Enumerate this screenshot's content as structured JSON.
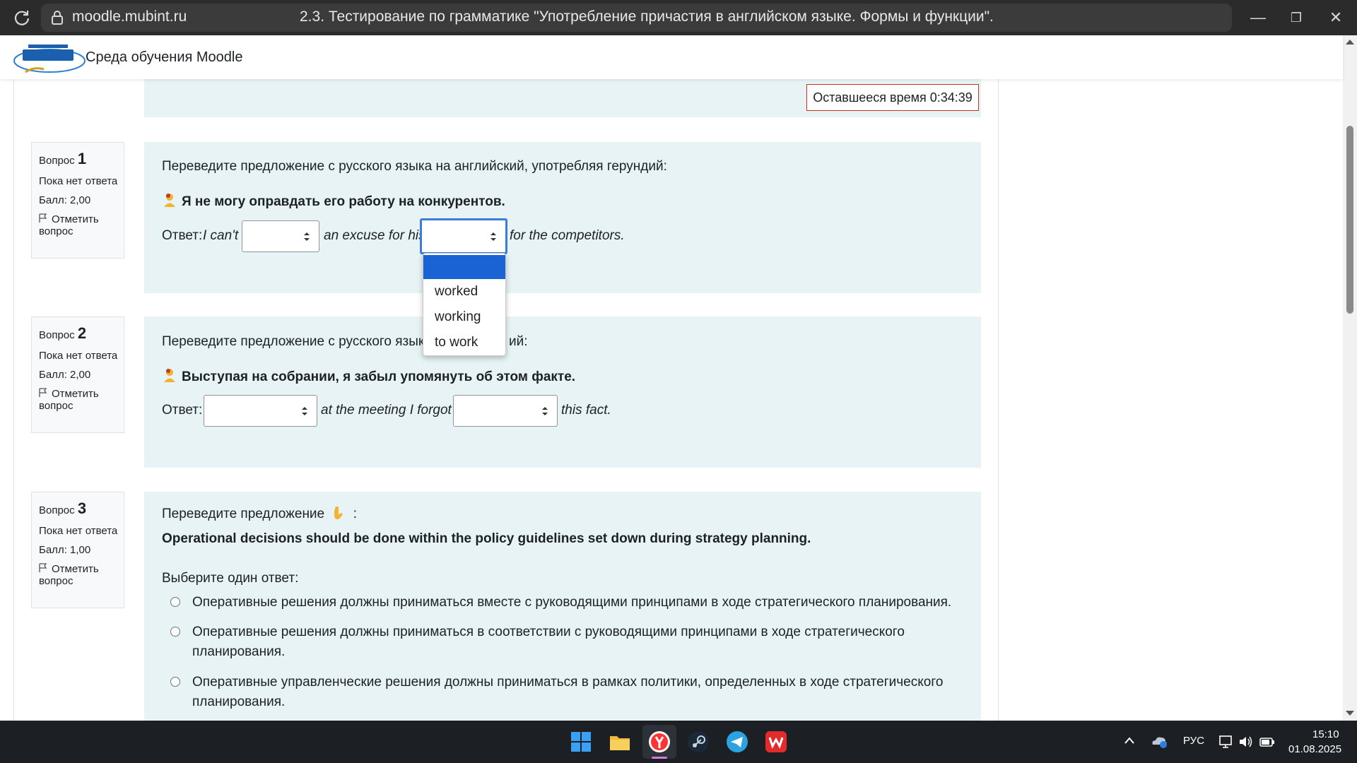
{
  "browser": {
    "url": "moodle.mubint.ru",
    "tab_title": "2.3. Тестирование по грамматике \"Употребление причастия в английском языке. Формы и функции\".",
    "minimize": "—",
    "restore": "❐",
    "close": "✕"
  },
  "site": {
    "name": "Среда обучения Moodle"
  },
  "timer": {
    "text": "Оставшееся время 0:34:39"
  },
  "questions": [
    {
      "label": "Вопрос",
      "number": "1",
      "status": "Пока нет ответа",
      "grade": "Балл: 2,00",
      "flag_line1": "Отметить",
      "flag_line2": "вопрос",
      "prompt": "Переведите предложение с русского языка на английский, употребляя герундий:",
      "sentence": "Я не могу оправдать его работу на конкурентов.",
      "answer_label": "Ответ:",
      "part1": "I can't",
      "part2": "an excuse for his",
      "part3": "for the competitors."
    },
    {
      "label": "Вопрос",
      "number": "2",
      "status": "Пока нет ответа",
      "grade": "Балл: 2,00",
      "flag_line1": "Отметить",
      "flag_line2": "вопрос",
      "prompt_visible_a": "Переведите предложение с русского языка",
      "prompt_visible_b": "ий:",
      "sentence": "Выступая на собрании, я забыл упомянуть об этом факте.",
      "answer_label": "Ответ:",
      "part1": "at the meeting I forgot",
      "part2": "this fact."
    },
    {
      "label": "Вопрос",
      "number": "3",
      "status": "Пока нет ответа",
      "grade": "Балл: 1,00",
      "flag_line1": "Отметить",
      "flag_line2": "вопрос",
      "prompt": "Переведите предложение",
      "prompt_colon": ":",
      "sentence": "Operational decisions should be done within the policy guidelines set down during strategy planning.",
      "choose_label": "Выберите один ответ:",
      "options": [
        {
          "line1": "Оперативные решения должны приниматься вместе с руководящими принципами в ходе стратегического планирования.",
          "line2": ""
        },
        {
          "line1": "Оперативные решения должны приниматься в соответствии с руководящими принципами в ходе стратегического",
          "line2": "планирования."
        },
        {
          "line1": "Оперативные управленческие решения должны приниматься в рамках политики, определенных в ходе стратегического",
          "line2": "планирования."
        }
      ]
    }
  ],
  "dropdown": {
    "options": [
      "",
      "worked",
      "working",
      "to work"
    ],
    "selected_index": 0
  },
  "taskbar": {
    "language": "РУС",
    "time": "15:10",
    "date": "01.08.2025"
  },
  "colors": {
    "panel_bg": "#e7f3f5",
    "accent_blue": "#1a63d4",
    "timer_border": "#ca3120"
  }
}
